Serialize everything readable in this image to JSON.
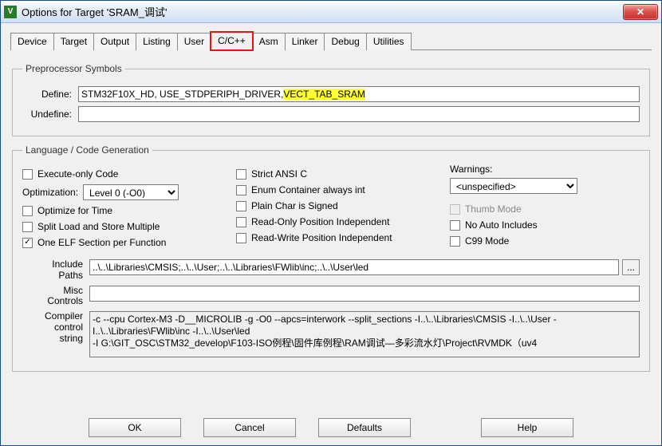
{
  "window": {
    "title": "Options for Target 'SRAM_调试'"
  },
  "tabs": [
    "Device",
    "Target",
    "Output",
    "Listing",
    "User",
    "C/C++",
    "Asm",
    "Linker",
    "Debug",
    "Utilities"
  ],
  "active_tab_index": 5,
  "preproc": {
    "legend": "Preprocessor Symbols",
    "define_label": "Define:",
    "define_value_plain": "STM32F10X_HD, USE_STDPERIPH_DRIVER,",
    "define_value_hl": "VECT_TAB_SRAM",
    "undefine_label": "Undefine:",
    "undefine_value": ""
  },
  "lang": {
    "legend": "Language / Code Generation",
    "left": {
      "execute_only": {
        "label": "Execute-only Code",
        "checked": false
      },
      "optimization_label": "Optimization:",
      "optimization_value": "Level 0 (-O0)",
      "optimize_time": {
        "label": "Optimize for Time",
        "checked": false
      },
      "split_load": {
        "label": "Split Load and Store Multiple",
        "checked": false
      },
      "one_elf": {
        "label": "One ELF Section per Function",
        "checked": true
      }
    },
    "mid": {
      "strict_ansi": {
        "label": "Strict ANSI C",
        "checked": false
      },
      "enum_int": {
        "label": "Enum Container always int",
        "checked": false
      },
      "plain_char": {
        "label": "Plain Char is Signed",
        "checked": false
      },
      "ro_pi": {
        "label": "Read-Only Position Independent",
        "checked": false
      },
      "rw_pi": {
        "label": "Read-Write Position Independent",
        "checked": false
      }
    },
    "right": {
      "warnings_label": "Warnings:",
      "warnings_value": "<unspecified>",
      "thumb": {
        "label": "Thumb Mode",
        "checked": false,
        "disabled": true
      },
      "no_auto_inc": {
        "label": "No Auto Includes",
        "checked": false
      },
      "c99": {
        "label": "C99 Mode",
        "checked": false
      }
    },
    "paths": {
      "include_label": "Include\nPaths",
      "include_value": "..\\..\\Libraries\\CMSIS;..\\..\\User;..\\..\\Libraries\\FWlib\\inc;..\\..\\User\\led",
      "misc_label": "Misc\nControls",
      "misc_value": "",
      "compiler_label": "Compiler\ncontrol\nstring",
      "compiler_value": "-c --cpu Cortex-M3 -D__MICROLIB -g -O0 --apcs=interwork --split_sections -I..\\..\\Libraries\\CMSIS -I..\\..\\User -I..\\..\\Libraries\\FWlib\\inc -I..\\..\\User\\led\n-I G:\\GIT_OSC\\STM32_develop\\F103-ISO例程\\固件库例程\\RAM调试—多彩流水灯\\Project\\RVMDK（uv4"
    }
  },
  "buttons": {
    "ok": "OK",
    "cancel": "Cancel",
    "defaults": "Defaults",
    "help": "Help"
  },
  "icons": {
    "dots": "...",
    "close": "✕",
    "check": "✓",
    "dropdown": "▼",
    "up": "▲",
    "down": "▼"
  }
}
